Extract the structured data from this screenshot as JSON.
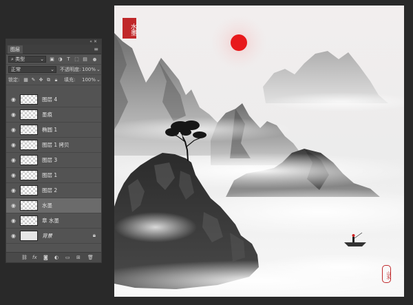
{
  "panel": {
    "tab_label": "图层",
    "filter_type_label": "类型",
    "blend_mode": "正常",
    "opacity_label": "不透明度:",
    "opacity_value": "100%",
    "lock_label": "锁定:",
    "fill_label": "填充:",
    "fill_value": "100%",
    "layers": [
      {
        "name": "图层 4",
        "visible": true,
        "selected": false,
        "locked": false
      },
      {
        "name": "墨痕",
        "visible": true,
        "selected": false,
        "locked": false
      },
      {
        "name": "椭圆 1",
        "visible": true,
        "selected": false,
        "locked": false
      },
      {
        "name": "图层 1 拷贝",
        "visible": true,
        "selected": false,
        "locked": false
      },
      {
        "name": "图层 3",
        "visible": true,
        "selected": false,
        "locked": false
      },
      {
        "name": "图层 1",
        "visible": true,
        "selected": false,
        "locked": false
      },
      {
        "name": "图层 2",
        "visible": true,
        "selected": false,
        "locked": false
      },
      {
        "name": "水墨",
        "visible": true,
        "selected": true,
        "locked": false
      },
      {
        "name": "章 水墨",
        "visible": true,
        "selected": false,
        "locked": false
      },
      {
        "name": "背景",
        "visible": true,
        "selected": false,
        "locked": true
      }
    ],
    "footer_icons": [
      "link-icon",
      "fx-icon",
      "mask-icon",
      "adjustment-icon",
      "folder-icon",
      "new-layer-icon",
      "trash-icon"
    ]
  },
  "canvas": {
    "seal_top": "水墨",
    "seal_bottom": "山水",
    "sun_color": "#e8191b",
    "seal_color": "#c0282a"
  }
}
